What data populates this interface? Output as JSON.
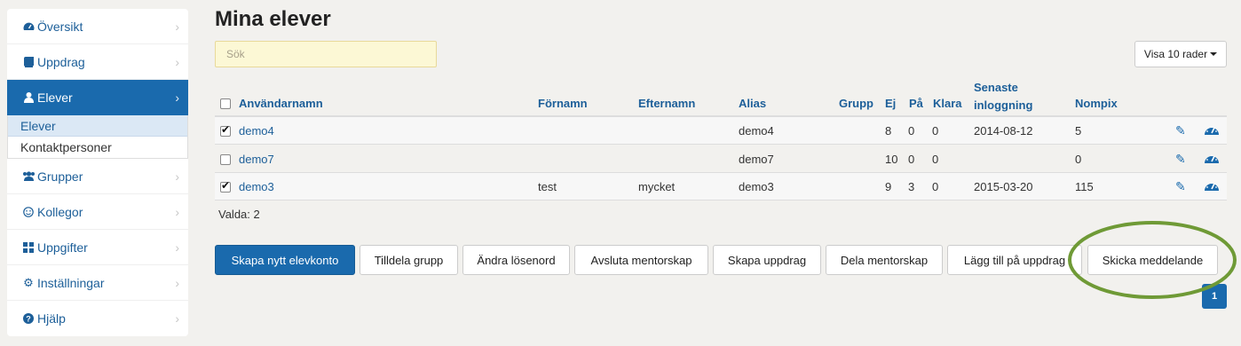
{
  "sidebar": {
    "items": [
      {
        "label": "Översikt",
        "icon": "dashboard-icon"
      },
      {
        "label": "Uppdrag",
        "icon": "book-icon"
      },
      {
        "label": "Elever",
        "icon": "user-icon"
      },
      {
        "label": "Grupper",
        "icon": "users-icon"
      },
      {
        "label": "Kollegor",
        "icon": "smile-icon"
      },
      {
        "label": "Uppgifter",
        "icon": "grid-icon"
      },
      {
        "label": "Inställningar",
        "icon": "gear-icon"
      },
      {
        "label": "Hjälp",
        "icon": "question-icon"
      }
    ],
    "subitems": [
      "Elever",
      "Kontaktpersoner"
    ]
  },
  "main": {
    "title": "Mina elever",
    "search_placeholder": "Sök",
    "rows_label": "Visa 10 rader",
    "columns": [
      "Användarnamn",
      "Förnamn",
      "Efternamn",
      "Alias",
      "Grupp",
      "Ej",
      "På",
      "Klara",
      "Senaste inloggning",
      "Nompix"
    ],
    "rows": [
      {
        "checked": true,
        "username": "demo4",
        "first": "",
        "last": "",
        "alias": "demo4",
        "group": "",
        "ej": "8",
        "pa": "0",
        "klara": "0",
        "login": "2014-08-12",
        "nompix": "5"
      },
      {
        "checked": false,
        "username": "demo7",
        "first": "",
        "last": "",
        "alias": "demo7",
        "group": "",
        "ej": "10",
        "pa": "0",
        "klara": "0",
        "login": "",
        "nompix": "0"
      },
      {
        "checked": true,
        "username": "demo3",
        "first": "test",
        "last": "mycket",
        "alias": "demo3",
        "group": "",
        "ej": "9",
        "pa": "3",
        "klara": "0",
        "login": "2015-03-20",
        "nompix": "115"
      }
    ],
    "selected_label": "Valda: 2",
    "buttons": [
      "Skapa nytt elevkonto",
      "Tilldela grupp",
      "Ändra lösenord",
      "Avsluta mentorskap",
      "Skapa uppdrag",
      "Dela mentorskap",
      "Lägg till på uppdrag",
      "Skicka meddelande"
    ],
    "page": "1"
  },
  "colors": {
    "accent": "#1a6aad",
    "highlight_circle": "#6f9a36",
    "search_bg": "#fcf8d5"
  }
}
